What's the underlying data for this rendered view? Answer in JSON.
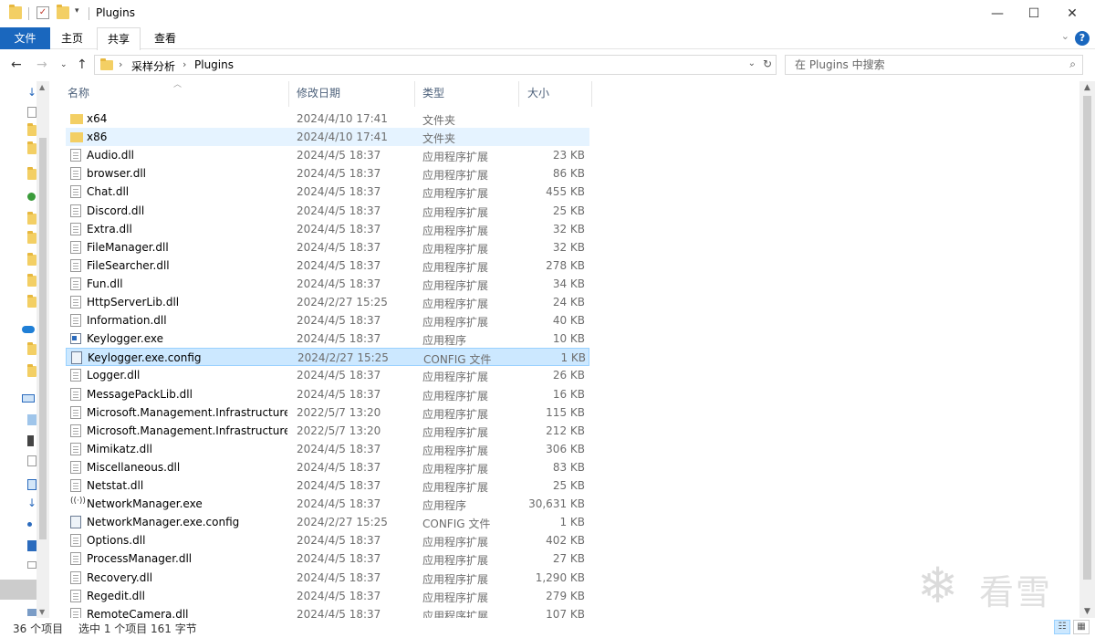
{
  "window": {
    "title": "Plugins",
    "controls": {
      "minimize": "—",
      "maximize": "☐",
      "close": "✕"
    }
  },
  "ribbon": {
    "tabs": [
      "文件",
      "主页",
      "共享",
      "查看"
    ],
    "active_tab": "共享",
    "help": "?"
  },
  "address": {
    "breadcrumbs": [
      "采样分析",
      "Plugins"
    ],
    "search_placeholder": "在 Plugins 中搜索"
  },
  "columns": {
    "name": "名称",
    "date": "修改日期",
    "type": "类型",
    "size": "大小"
  },
  "files": [
    {
      "name": "x64",
      "date": "2024/4/10 17:41",
      "type": "文件夹",
      "size": "",
      "icon": "folder"
    },
    {
      "name": "x86",
      "date": "2024/4/10 17:41",
      "type": "文件夹",
      "size": "",
      "icon": "folder",
      "state": "hover"
    },
    {
      "name": "Audio.dll",
      "date": "2024/4/5 18:37",
      "type": "应用程序扩展",
      "size": "23 KB",
      "icon": "file"
    },
    {
      "name": "browser.dll",
      "date": "2024/4/5 18:37",
      "type": "应用程序扩展",
      "size": "86 KB",
      "icon": "file"
    },
    {
      "name": "Chat.dll",
      "date": "2024/4/5 18:37",
      "type": "应用程序扩展",
      "size": "455 KB",
      "icon": "file"
    },
    {
      "name": "Discord.dll",
      "date": "2024/4/5 18:37",
      "type": "应用程序扩展",
      "size": "25 KB",
      "icon": "file"
    },
    {
      "name": "Extra.dll",
      "date": "2024/4/5 18:37",
      "type": "应用程序扩展",
      "size": "32 KB",
      "icon": "file"
    },
    {
      "name": "FileManager.dll",
      "date": "2024/4/5 18:37",
      "type": "应用程序扩展",
      "size": "32 KB",
      "icon": "file"
    },
    {
      "name": "FileSearcher.dll",
      "date": "2024/4/5 18:37",
      "type": "应用程序扩展",
      "size": "278 KB",
      "icon": "file"
    },
    {
      "name": "Fun.dll",
      "date": "2024/4/5 18:37",
      "type": "应用程序扩展",
      "size": "34 KB",
      "icon": "file"
    },
    {
      "name": "HttpServerLib.dll",
      "date": "2024/2/27 15:25",
      "type": "应用程序扩展",
      "size": "24 KB",
      "icon": "file"
    },
    {
      "name": "Information.dll",
      "date": "2024/4/5 18:37",
      "type": "应用程序扩展",
      "size": "40 KB",
      "icon": "file"
    },
    {
      "name": "Keylogger.exe",
      "date": "2024/4/5 18:37",
      "type": "应用程序",
      "size": "10 KB",
      "icon": "exe"
    },
    {
      "name": "Keylogger.exe.config",
      "date": "2024/2/27 15:25",
      "type": "CONFIG 文件",
      "size": "1 KB",
      "icon": "config",
      "state": "selected"
    },
    {
      "name": "Logger.dll",
      "date": "2024/4/5 18:37",
      "type": "应用程序扩展",
      "size": "26 KB",
      "icon": "file"
    },
    {
      "name": "MessagePackLib.dll",
      "date": "2024/4/5 18:37",
      "type": "应用程序扩展",
      "size": "16 KB",
      "icon": "file"
    },
    {
      "name": "Microsoft.Management.Infrastructure...",
      "date": "2022/5/7 13:20",
      "type": "应用程序扩展",
      "size": "115 KB",
      "icon": "file"
    },
    {
      "name": "Microsoft.Management.Infrastructure...",
      "date": "2022/5/7 13:20",
      "type": "应用程序扩展",
      "size": "212 KB",
      "icon": "file"
    },
    {
      "name": "Mimikatz.dll",
      "date": "2024/4/5 18:37",
      "type": "应用程序扩展",
      "size": "306 KB",
      "icon": "file"
    },
    {
      "name": "Miscellaneous.dll",
      "date": "2024/4/5 18:37",
      "type": "应用程序扩展",
      "size": "83 KB",
      "icon": "file"
    },
    {
      "name": "Netstat.dll",
      "date": "2024/4/5 18:37",
      "type": "应用程序扩展",
      "size": "25 KB",
      "icon": "file"
    },
    {
      "name": "NetworkManager.exe",
      "date": "2024/4/5 18:37",
      "type": "应用程序",
      "size": "30,631 KB",
      "icon": "net"
    },
    {
      "name": "NetworkManager.exe.config",
      "date": "2024/2/27 15:25",
      "type": "CONFIG 文件",
      "size": "1 KB",
      "icon": "config"
    },
    {
      "name": "Options.dll",
      "date": "2024/4/5 18:37",
      "type": "应用程序扩展",
      "size": "402 KB",
      "icon": "file"
    },
    {
      "name": "ProcessManager.dll",
      "date": "2024/4/5 18:37",
      "type": "应用程序扩展",
      "size": "27 KB",
      "icon": "file"
    },
    {
      "name": "Recovery.dll",
      "date": "2024/4/5 18:37",
      "type": "应用程序扩展",
      "size": "1,290 KB",
      "icon": "file"
    },
    {
      "name": "Regedit.dll",
      "date": "2024/4/5 18:37",
      "type": "应用程序扩展",
      "size": "279 KB",
      "icon": "file"
    },
    {
      "name": "RemoteCamera.dll",
      "date": "2024/4/5 18:37",
      "type": "应用程序扩展",
      "size": "107 KB",
      "icon": "file"
    }
  ],
  "status": {
    "count": "36 个项目",
    "selection": "选中 1 个项目",
    "bytes": "161 字节"
  },
  "watermark": {
    "text": "看雪"
  }
}
